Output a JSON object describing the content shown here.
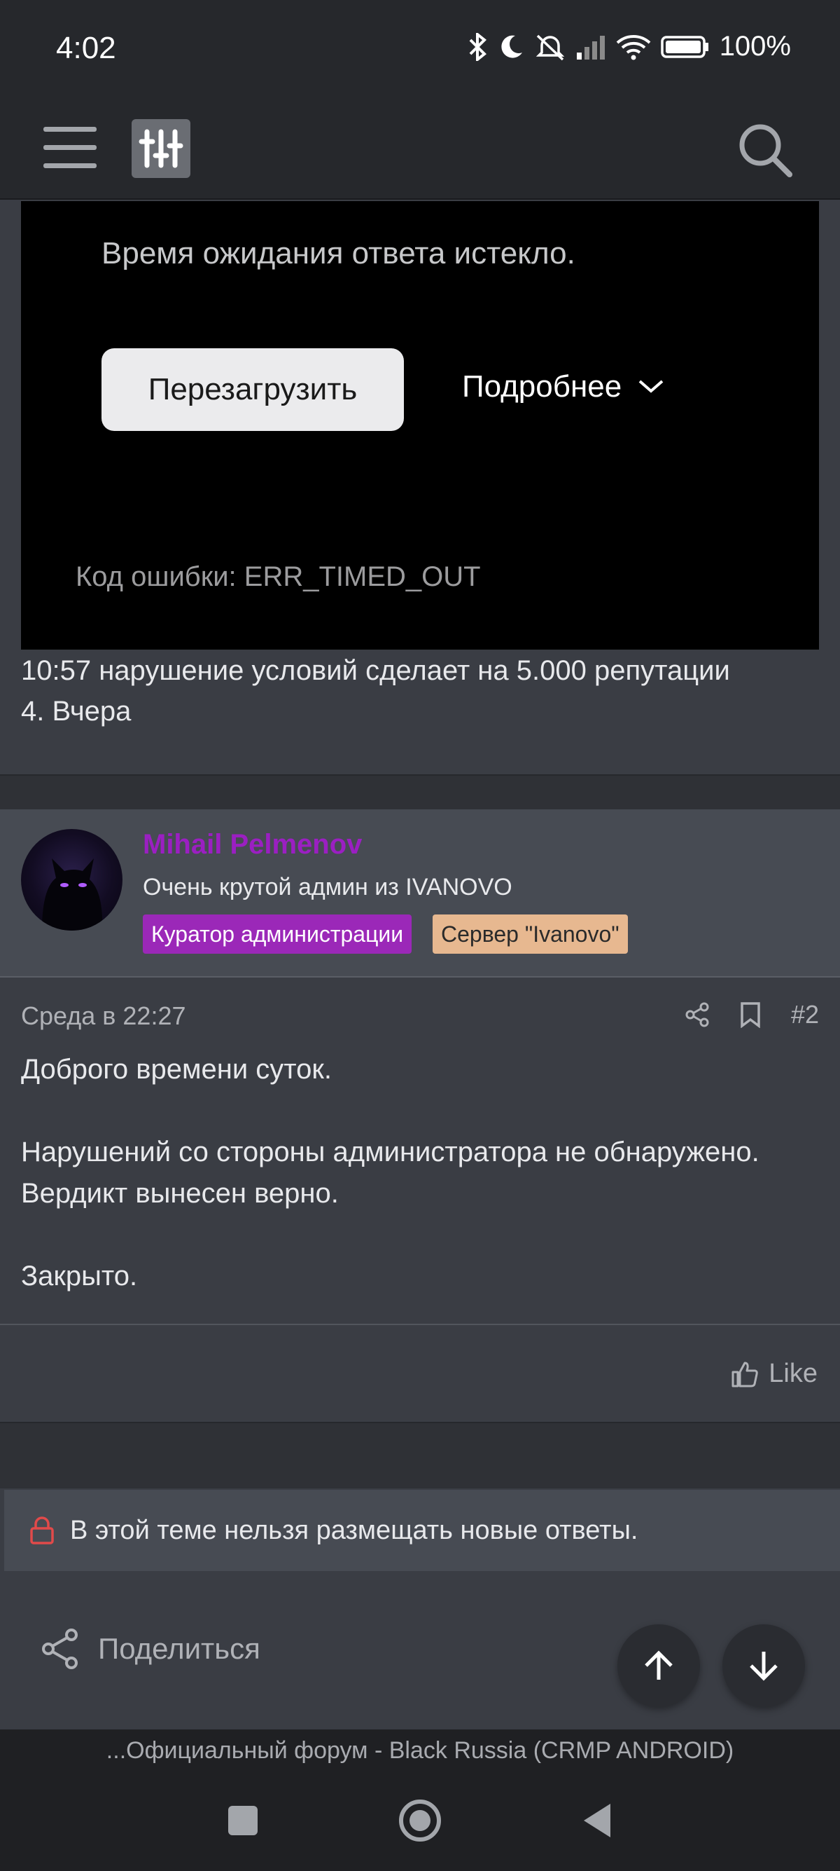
{
  "status_bar": {
    "time": "4:02",
    "battery": "100%",
    "icons": [
      "bluetooth-icon",
      "moon-icon",
      "mute-icon",
      "signal-icon",
      "wifi-icon",
      "battery-icon"
    ]
  },
  "app_bar": {
    "icons": [
      "menu-icon",
      "filter-icon",
      "search-icon"
    ]
  },
  "embedded_error": {
    "message": "Время ожидания ответа истекло.",
    "reload_label": "Перезагрузить",
    "details_label": "Подробнее",
    "error_code": "Код ошибки: ERR_TIMED_OUT"
  },
  "previous_post": {
    "line1": "10:57 нарушение условий сделает на 5.000 репутации",
    "line2": "4. Вчера"
  },
  "author": {
    "name": "Mihail Pelmenov",
    "title": "Очень крутой админ из IVANOVO",
    "badges": [
      "Куратор администрации",
      "Сервер \"Ivanovo\""
    ],
    "colors": {
      "name": "#9b1fc2",
      "badge1": "#9b28b8",
      "badge2": "#e7b890"
    }
  },
  "post": {
    "date": "Среда в 22:27",
    "number": "#2",
    "paragraphs": [
      "Доброго времени суток.",
      "Нарушений со стороны администратора не обнаружено.",
      "Вердикт вынесен верно.",
      "Закрыто."
    ],
    "like_label": "Like"
  },
  "locked_notice": "В этой теме нельзя размещать новые ответы.",
  "share_label": "Поделиться",
  "url_title": "...Официальный форум - Black Russia (CRMP ANDROID)"
}
